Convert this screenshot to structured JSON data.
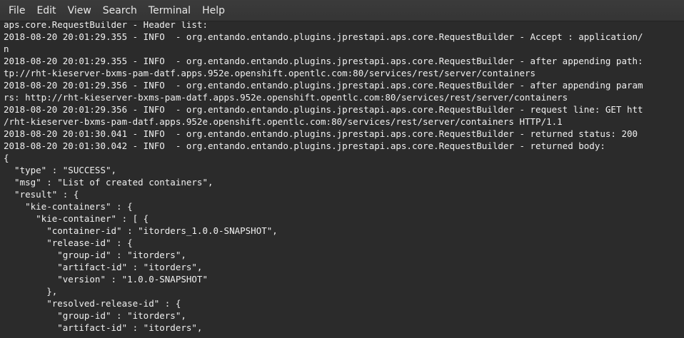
{
  "menubar": {
    "items": [
      "File",
      "Edit",
      "View",
      "Search",
      "Terminal",
      "Help"
    ]
  },
  "terminal": {
    "lines": [
      "aps.core.RequestBuilder - Header list:",
      "2018-08-20 20:01:29.355 - INFO  - org.entando.entando.plugins.jprestapi.aps.core.RequestBuilder - Accept : application/",
      "n",
      "2018-08-20 20:01:29.355 - INFO  - org.entando.entando.plugins.jprestapi.aps.core.RequestBuilder - after appending path:",
      "tp://rht-kieserver-bxms-pam-datf.apps.952e.openshift.opentlc.com:80/services/rest/server/containers",
      "2018-08-20 20:01:29.356 - INFO  - org.entando.entando.plugins.jprestapi.aps.core.RequestBuilder - after appending param",
      "rs: http://rht-kieserver-bxms-pam-datf.apps.952e.openshift.opentlc.com:80/services/rest/server/containers",
      "2018-08-20 20:01:29.356 - INFO  - org.entando.entando.plugins.jprestapi.aps.core.RequestBuilder - request line: GET htt",
      "/rht-kieserver-bxms-pam-datf.apps.952e.openshift.opentlc.com:80/services/rest/server/containers HTTP/1.1",
      "2018-08-20 20:01:30.041 - INFO  - org.entando.entando.plugins.jprestapi.aps.core.RequestBuilder - returned status: 200",
      "2018-08-20 20:01:30.042 - INFO  - org.entando.entando.plugins.jprestapi.aps.core.RequestBuilder - returned body:",
      "{",
      "  \"type\" : \"SUCCESS\",",
      "  \"msg\" : \"List of created containers\",",
      "  \"result\" : {",
      "    \"kie-containers\" : {",
      "      \"kie-container\" : [ {",
      "        \"container-id\" : \"itorders_1.0.0-SNAPSHOT\",",
      "        \"release-id\" : {",
      "          \"group-id\" : \"itorders\",",
      "          \"artifact-id\" : \"itorders\",",
      "          \"version\" : \"1.0.0-SNAPSHOT\"",
      "        },",
      "        \"resolved-release-id\" : {",
      "          \"group-id\" : \"itorders\",",
      "          \"artifact-id\" : \"itorders\","
    ]
  },
  "colors": {
    "menubar_bg": "#383838",
    "terminal_bg": "#2b2b2b",
    "text": "#f0f0f0"
  }
}
